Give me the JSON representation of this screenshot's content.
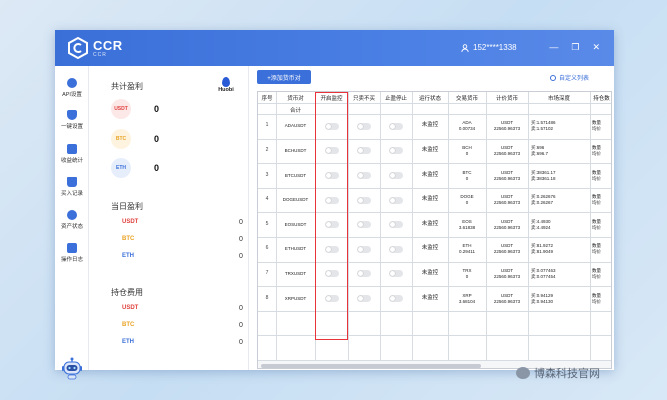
{
  "app": {
    "name": "CCR",
    "subtitle": "CCR",
    "user": "152****1338"
  },
  "window_controls": [
    "—",
    "❐",
    "✕"
  ],
  "sidebar": {
    "items": [
      {
        "label": "API设置",
        "icon": "api-icon"
      },
      {
        "label": "一键设置",
        "icon": "shield-icon"
      },
      {
        "label": "收益统计",
        "icon": "wallet-icon"
      },
      {
        "label": "买入记录",
        "icon": "cart-icon"
      },
      {
        "label": "资产状态",
        "icon": "cloud-icon"
      },
      {
        "label": "操作日志",
        "icon": "log-icon"
      }
    ]
  },
  "summary": {
    "exchange": "Huobi",
    "total_profit": {
      "title": "共计盈利",
      "rows": [
        {
          "coin": "USDT",
          "value": "0"
        },
        {
          "coin": "BTC",
          "value": "0"
        },
        {
          "coin": "ETH",
          "value": "0"
        }
      ]
    },
    "daily_profit": {
      "title": "当日盈利",
      "rows": [
        {
          "coin": "USDT",
          "value": "0"
        },
        {
          "coin": "BTC",
          "value": "0"
        },
        {
          "coin": "ETH",
          "value": "0"
        }
      ]
    },
    "position_cost": {
      "title": "持仓费用",
      "rows": [
        {
          "coin": "USDT",
          "value": "0"
        },
        {
          "coin": "BTC",
          "value": "0"
        },
        {
          "coin": "ETH",
          "value": "0"
        }
      ]
    }
  },
  "toolbar": {
    "add_label": "+添加货币对",
    "custom_label": "自定义列表"
  },
  "table": {
    "headers": [
      "序号",
      "货币对",
      "开启监控",
      "只卖不买",
      "止盈停止",
      "运行状态",
      "交易货币",
      "计价货币",
      "市场深度",
      "持仓数"
    ],
    "subheader": "合计",
    "rows": [
      {
        "idx": "1",
        "symbol": "ADAUSDT",
        "status": "未监控",
        "trade": [
          "ADA",
          "0.00734"
        ],
        "quote": [
          "USDT",
          "22560.96373"
        ],
        "depth": [
          "买:1.571486",
          "卖:1.57102"
        ],
        "hold": [
          "数量",
          "均价"
        ]
      },
      {
        "idx": "2",
        "symbol": "BCHUSDT",
        "status": "未监控",
        "trade": [
          "BCH",
          "0"
        ],
        "quote": [
          "USDT",
          "22560.96373"
        ],
        "depth": [
          "买:696",
          "卖:696.7"
        ],
        "hold": [
          "数量",
          "均价"
        ]
      },
      {
        "idx": "3",
        "symbol": "BTCUSDT",
        "status": "未监控",
        "trade": [
          "BTC",
          "0"
        ],
        "quote": [
          "USDT",
          "22560.96373"
        ],
        "depth": [
          "买:38361.17",
          "卖:38361.18"
        ],
        "hold": [
          "数量",
          "均价"
        ]
      },
      {
        "idx": "4",
        "symbol": "DOGEUSDT",
        "status": "未监控",
        "trade": [
          "DOGE",
          "0"
        ],
        "quote": [
          "USDT",
          "22560.96373"
        ],
        "depth": [
          "买:0.262676",
          "卖:0.26267"
        ],
        "hold": [
          "数量",
          "均价"
        ]
      },
      {
        "idx": "5",
        "symbol": "EOSUSDT",
        "status": "未监控",
        "trade": [
          "EOS",
          "3.61838"
        ],
        "quote": [
          "USDT",
          "22560.96373"
        ],
        "depth": [
          "买:4.4930",
          "卖:4.4924"
        ],
        "hold": [
          "数量",
          "均价"
        ]
      },
      {
        "idx": "6",
        "symbol": "ETHUSDT",
        "status": "未监控",
        "trade": [
          "ETH",
          "0.29411"
        ],
        "quote": [
          "USDT",
          "22560.96373"
        ],
        "depth": [
          "买:81.9272",
          "卖:81.9049"
        ],
        "hold": [
          "数量",
          "均价"
        ]
      },
      {
        "idx": "7",
        "symbol": "TRXUSDT",
        "status": "未监控",
        "trade": [
          "TRX",
          "0"
        ],
        "quote": [
          "USDT",
          "22560.96373"
        ],
        "depth": [
          "买:0.077463",
          "卖:0.077454"
        ],
        "hold": [
          "数量",
          "均价"
        ]
      },
      {
        "idx": "8",
        "symbol": "XRPUSDT",
        "status": "未监控",
        "trade": [
          "XRP",
          "3.68104"
        ],
        "quote": [
          "USDT",
          "22560.96373"
        ],
        "depth": [
          "买:0.94129",
          "卖:0.94130"
        ],
        "hold": [
          "数量",
          "均价"
        ]
      }
    ]
  },
  "watermark": "博森科技官网"
}
